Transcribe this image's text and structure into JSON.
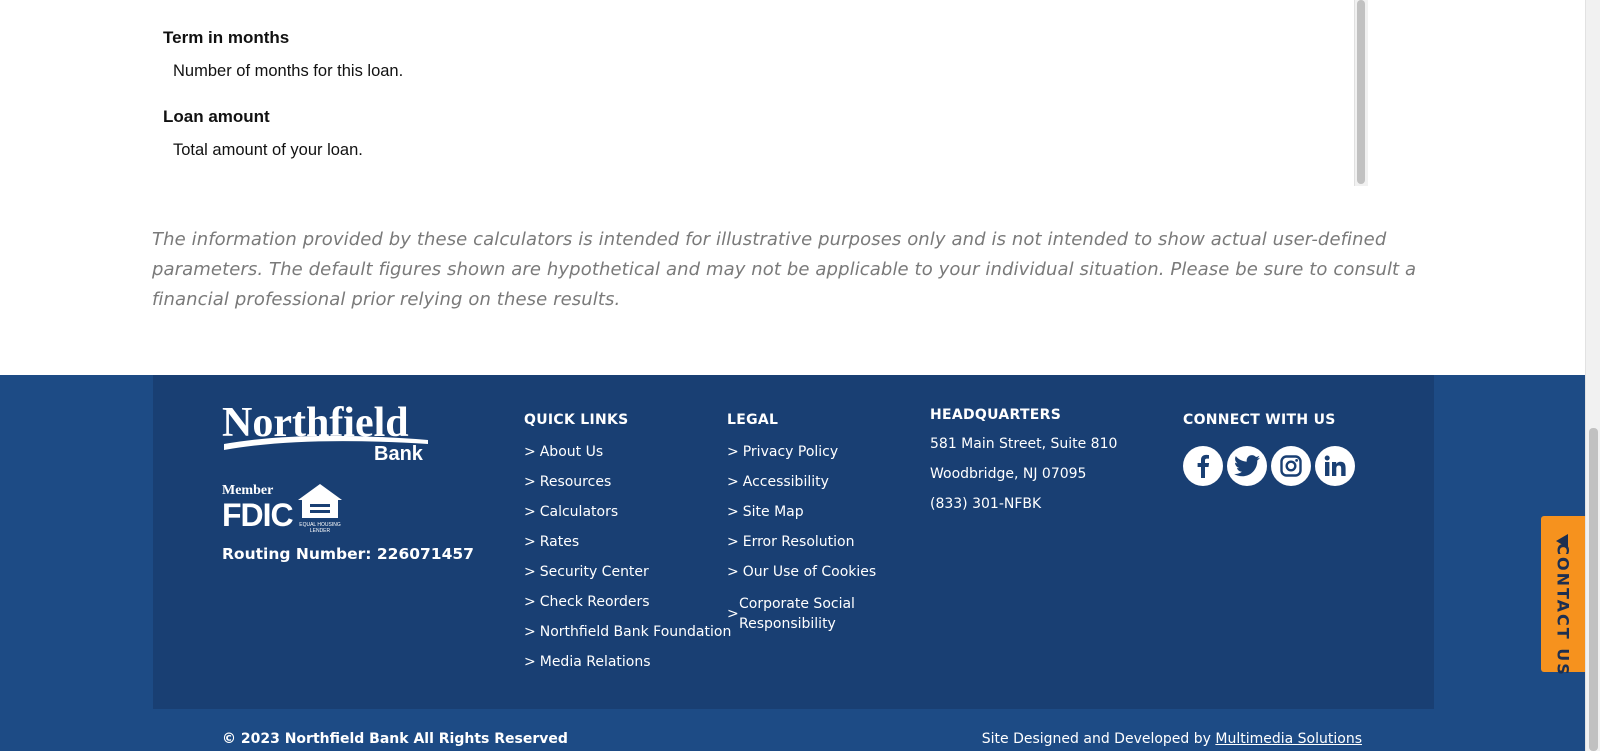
{
  "definitions": [
    {
      "term": "Term in months",
      "description": "Number of months for this loan."
    },
    {
      "term": "Loan amount",
      "description": "Total amount of your loan."
    }
  ],
  "disclaimer": "The information provided by these calculators is intended for illustrative purposes only and is not intended to show actual user-defined parameters. The default figures shown are hypothetical and may not be applicable to your individual situation.  Please be sure to consult a financial professional prior relying on these results.",
  "brand": {
    "logo_word": "Northfield",
    "logo_sub": "Bank",
    "fdic_member": "Member",
    "fdic": "FDIC",
    "ehl_line1": "EQUAL HOUSING",
    "ehl_line2": "LENDER",
    "routing": "Routing Number: 226071457"
  },
  "quick_links": {
    "title": "QUICK LINKS",
    "items": [
      "About Us",
      "Resources",
      "Calculators",
      "Rates",
      "Security Center",
      "Check Reorders",
      "Northfield Bank Foundation",
      "Media Relations"
    ]
  },
  "legal": {
    "title": "LEGAL",
    "items": [
      "Privacy Policy",
      "Accessibility",
      "Site Map",
      "Error Resolution",
      "Our Use of Cookies",
      "Corporate Social",
      "Responsibility"
    ]
  },
  "headquarters": {
    "title": "HEADQUARTERS",
    "line1": "581 Main Street, Suite 810",
    "line2": "Woodbridge, NJ 07095",
    "phone": "(833) 301-NFBK"
  },
  "connect": {
    "title": "CONNECT WITH US",
    "icons": [
      "facebook-icon",
      "twitter-icon",
      "instagram-icon",
      "linkedin-icon"
    ]
  },
  "footer_bottom": {
    "copyright": "© 2023 Northfield Bank All Rights Reserved",
    "credit_prefix": "Site Designed and Developed by",
    "credit_link": "Multimedia Solutions"
  },
  "contact_tab": {
    "label": "CONTACT US"
  },
  "gt": ">",
  "colors": {
    "footer_dark": "#193f73",
    "footer_band": "#1d4b85",
    "contact_orange": "#f6921e",
    "disclaimer_gray": "#7a7a7a"
  }
}
